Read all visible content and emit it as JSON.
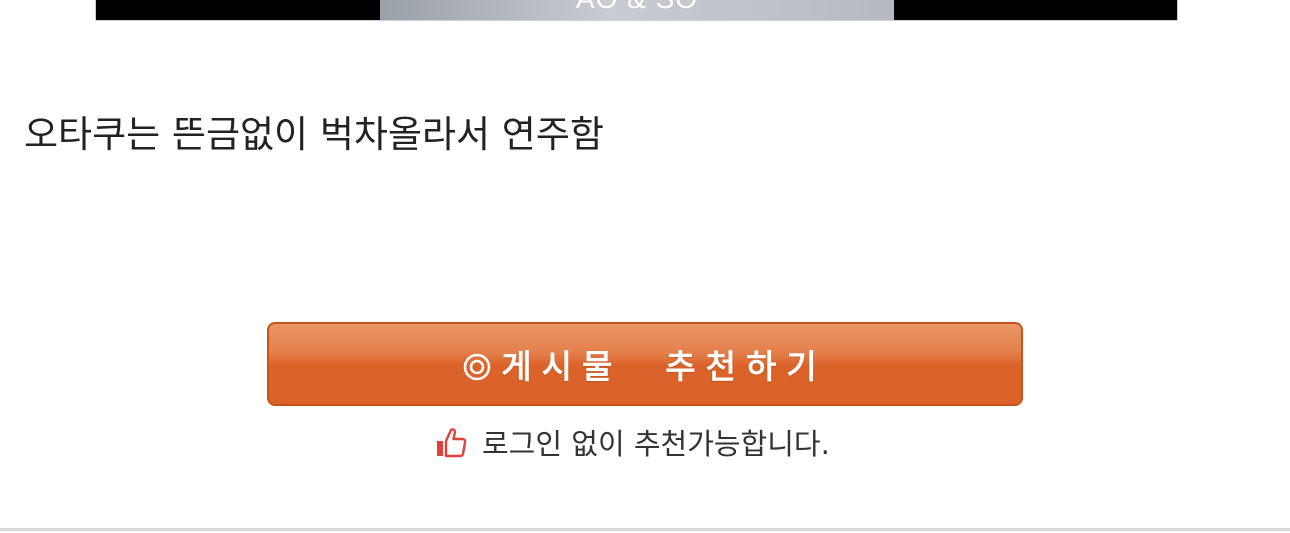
{
  "media": {
    "caption": "AO & SO"
  },
  "post": {
    "body_text": "오타쿠는 뜬금없이 벅차올라서 연주함"
  },
  "recommend": {
    "button_label": "게시물  추천하기",
    "button_icon": "target-icon",
    "note_icon": "thumbs-up-icon",
    "note_text": "로그인 없이 추천가능합니다.",
    "accent_color": "#db6229",
    "icon_color": "#e0413a"
  }
}
